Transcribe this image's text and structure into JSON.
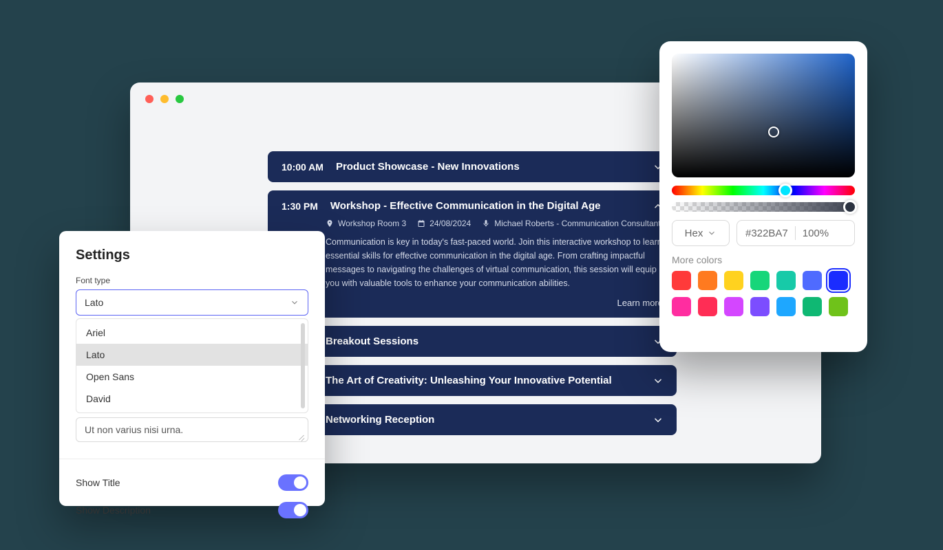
{
  "agenda": {
    "items": [
      {
        "time": "10:00 AM",
        "title": "Product Showcase - New Innovations",
        "open": false
      },
      {
        "time": "1:30 PM",
        "title": "Workshop - Effective Communication in the Digital Age",
        "open": true,
        "meta": {
          "location": "Workshop Room 3",
          "date": "24/08/2024",
          "speaker": "Michael Roberts - Communication Consultant"
        },
        "description": "Communication is key in today's fast-paced world. Join this interactive workshop to learn essential skills for effective communication in the digital age. From crafting impactful messages to navigating the challenges of virtual communication, this session will equip you with valuable tools to enhance your communication abilities.",
        "learn_more": "Learn more"
      },
      {
        "time": "",
        "title": "Breakout Sessions",
        "open": false
      },
      {
        "time": "",
        "title": "The Art of Creativity: Unleashing Your Innovative Potential",
        "open": false
      },
      {
        "time": "",
        "title": "Networking Reception",
        "open": false
      }
    ]
  },
  "settings": {
    "title": "Settings",
    "font_label": "Font type",
    "font_selected": "Lato",
    "font_options": [
      "Ariel",
      "Lato",
      "Open Sans",
      "David"
    ],
    "sample_text": "Ut non varius nisi urna.",
    "toggles": [
      {
        "label": "Show Title",
        "on": true
      },
      {
        "label": "Show Description",
        "on": true
      }
    ]
  },
  "picker": {
    "mode": "Hex",
    "value": "#322BA7",
    "alpha": "100%",
    "more_label": "More colors",
    "swatches": [
      "#ff3a3a",
      "#ff7a1f",
      "#ffd21f",
      "#17d67a",
      "#17caa8",
      "#4f6bff",
      "#1a2cff",
      "#ff2da0",
      "#ff2d55",
      "#d446ff",
      "#7c4dff",
      "#1ea7ff",
      "#0fb873",
      "#6fc21a"
    ],
    "selected_swatch_index": 6
  }
}
